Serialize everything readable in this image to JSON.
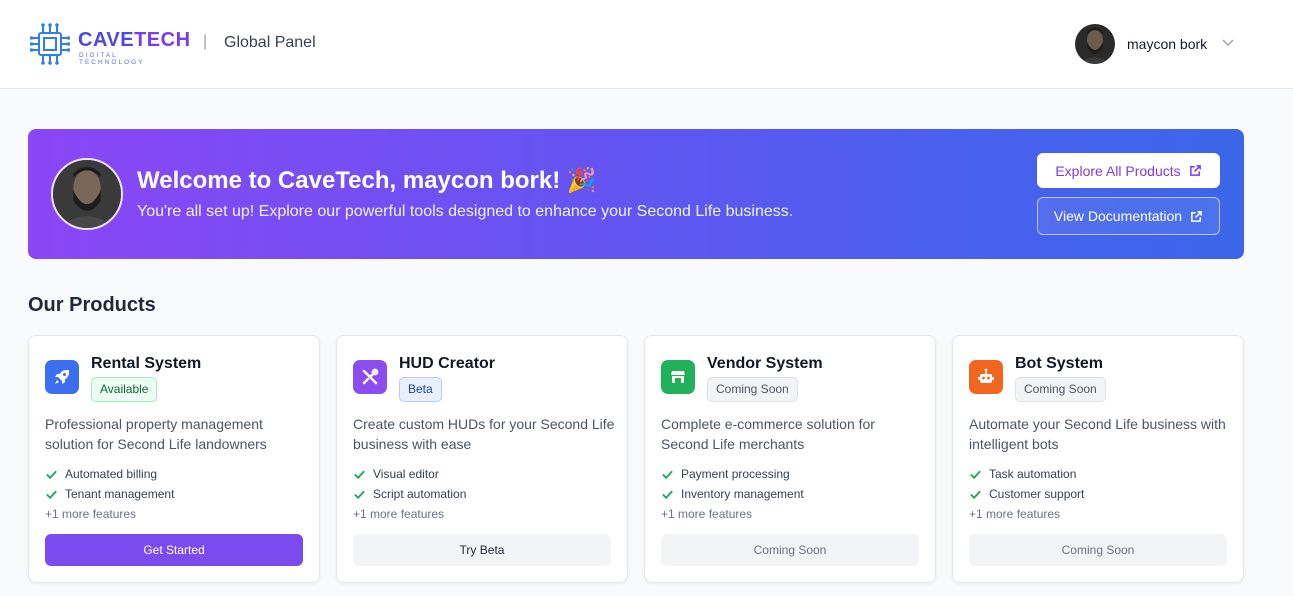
{
  "header": {
    "logo_word_a": "CAVE",
    "logo_word_b": "TECH",
    "logo_tagline": "DIGITAL TECHNOLOGY",
    "separator": "|",
    "panel_title": "Global Panel",
    "user_name": "maycon bork"
  },
  "banner": {
    "welcome": "Welcome to CaveTech, maycon bork! 🎉",
    "subtitle": "You're all set up! Explore our powerful tools designed to enhance your Second Life business.",
    "explore_label": "Explore All Products",
    "docs_label": "View Documentation"
  },
  "products_title": "Our Products",
  "products": [
    {
      "title": "Rental System",
      "badge": "Available",
      "description": "Professional property management solution for Second Life landowners",
      "features": [
        "Automated billing",
        "Tenant management"
      ],
      "more": "+1 more features",
      "button": "Get Started",
      "icon": "rocket-icon",
      "color": "#3b6ff0"
    },
    {
      "title": "HUD Creator",
      "badge": "Beta",
      "description": "Create custom HUDs for your Second Life business with ease",
      "features": [
        "Visual editor",
        "Script automation"
      ],
      "more": "+1 more features",
      "button": "Try Beta",
      "icon": "tools-icon",
      "color": "#8b4cf0"
    },
    {
      "title": "Vendor System",
      "badge": "Coming Soon",
      "description": "Complete e-commerce solution for Second Life merchants",
      "features": [
        "Payment processing",
        "Inventory management"
      ],
      "more": "+1 more features",
      "button": "Coming Soon",
      "icon": "store-icon",
      "color": "#20b15a"
    },
    {
      "title": "Bot System",
      "badge": "Coming Soon",
      "description": "Automate your Second Life business with intelligent bots",
      "features": [
        "Task automation",
        "Customer support"
      ],
      "more": "+1 more features",
      "button": "Coming Soon",
      "icon": "robot-icon",
      "color": "#f0661f"
    }
  ],
  "colors": {
    "accent": "#7c3aed",
    "check": "#22a55b"
  }
}
